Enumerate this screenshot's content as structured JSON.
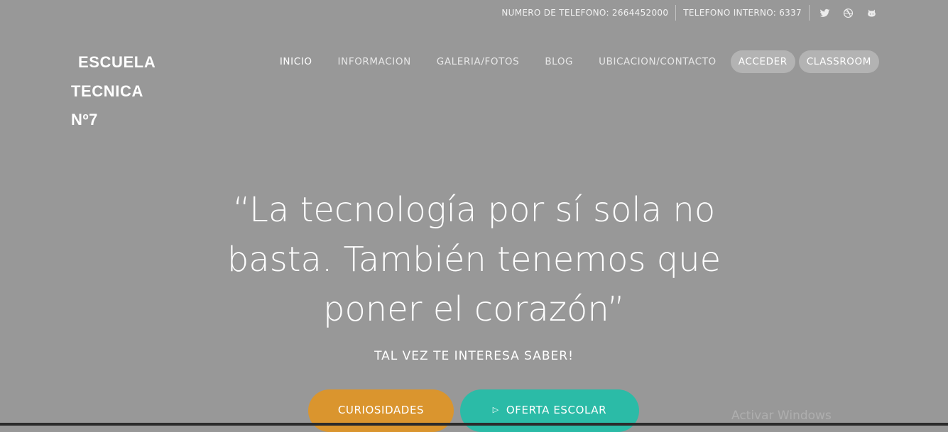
{
  "topbar": {
    "phone": "NUMERO DE TELEFONO: 2664452000",
    "internal": "TELEFONO INTERNO: 6337",
    "icons": [
      "twitter-icon",
      "dribbble-icon",
      "github-icon"
    ]
  },
  "logo": {
    "line1": "ESCUELA",
    "line2": "TECNICA",
    "line3": "Nº7"
  },
  "nav": {
    "items": [
      "INICIO",
      "INFORMACION",
      "GALERIA/FOTOS",
      "BLOG",
      "UBICACION/CONTACTO"
    ],
    "acceder": "ACCEDER",
    "classroom": "CLASSROOM"
  },
  "hero": {
    "quote": "“La tecnología por sí sola no basta. También tenemos que poner el corazón”",
    "subtitle": "TAL VEZ TE INTERESA SABER!",
    "btn_curiosidades": "CURIOSIDADES",
    "btn_oferta": "OFERTA ESCOLAR"
  },
  "watermark": "Activar Windows",
  "colors": {
    "background": "#989898",
    "orange": "#da952e",
    "teal": "#2bbba7",
    "pill": "#b3b3b3"
  }
}
